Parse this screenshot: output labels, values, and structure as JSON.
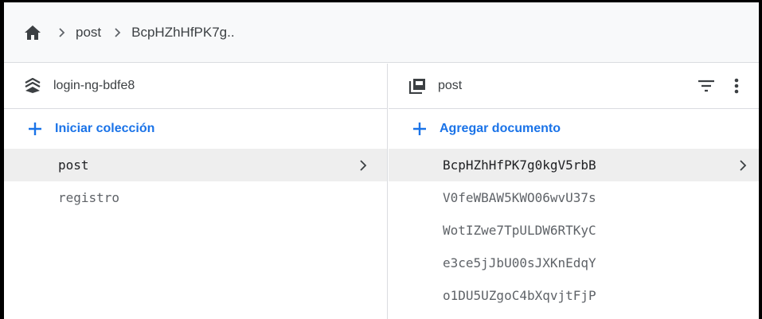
{
  "breadcrumb": {
    "home_icon": "home-icon",
    "items": [
      "post",
      "BcpHZhHfPK7g.."
    ]
  },
  "left_panel": {
    "icon": "database-icon",
    "title": "login-ng-bdfe8",
    "add_label": "Iniciar colección",
    "collections": [
      {
        "name": "post",
        "selected": true
      },
      {
        "name": "registro",
        "selected": false
      }
    ]
  },
  "right_panel": {
    "icon": "collection-icon",
    "title": "post",
    "filter_icon": "filter-icon",
    "more_icon": "more-vert-icon",
    "add_label": "Agregar documento",
    "documents": [
      {
        "id": "BcpHZhHfPK7g0kgV5rbB",
        "selected": true
      },
      {
        "id": "V0feWBAW5KWO06wvU37s",
        "selected": false
      },
      {
        "id": "WotIZwe7TpULDW6RTKyC",
        "selected": false
      },
      {
        "id": "e3ce5jJbU00sJXKnEdqY",
        "selected": false
      },
      {
        "id": "o1DU5UZgoC4bXqvjtFjP",
        "selected": false
      }
    ]
  },
  "colors": {
    "accent": "#1a73e8",
    "selected_bg": "#eeeeee",
    "breadcrumb_bg": "#f8f9fa"
  }
}
